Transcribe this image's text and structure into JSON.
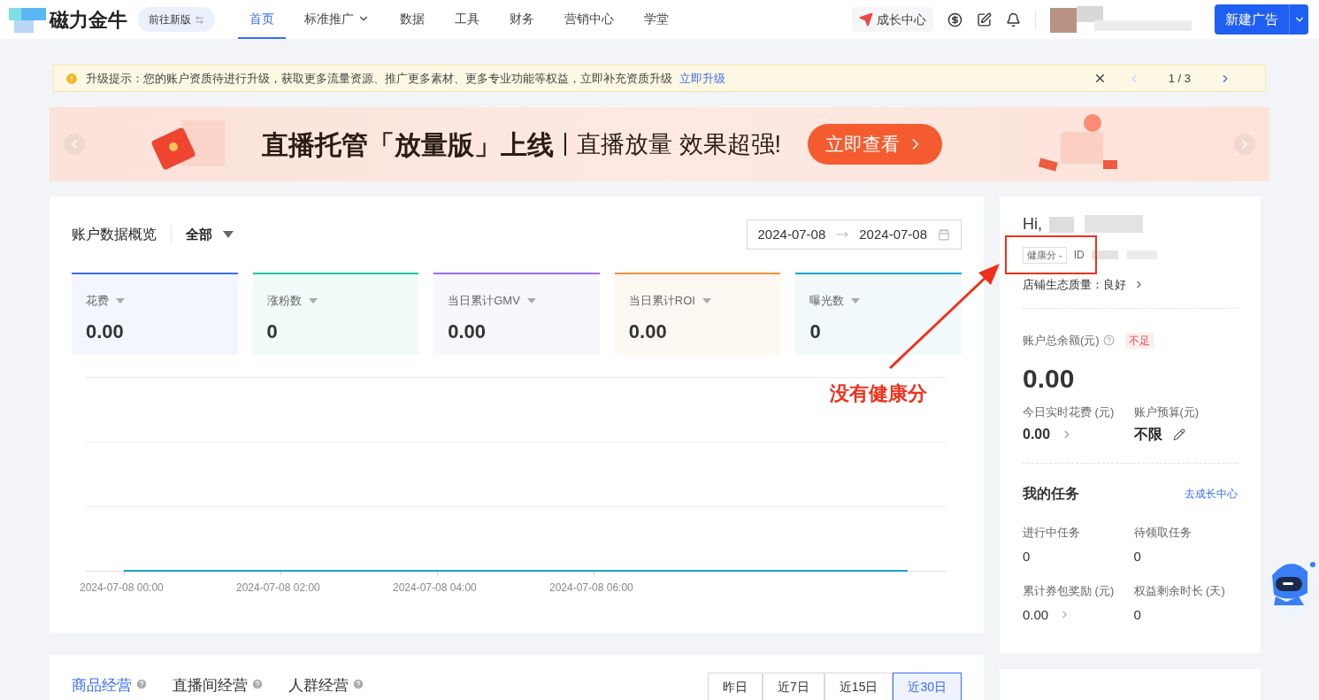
{
  "header": {
    "logo": "磁力金牛",
    "switch_version": "前往新版",
    "nav": [
      {
        "label": "首页",
        "selected": true,
        "dropdown": false
      },
      {
        "label": "标准推广",
        "selected": false,
        "dropdown": true
      },
      {
        "label": "数据",
        "selected": false,
        "dropdown": false
      },
      {
        "label": "工具",
        "selected": false,
        "dropdown": false
      },
      {
        "label": "财务",
        "selected": false,
        "dropdown": false
      },
      {
        "label": "营销中心",
        "selected": false,
        "dropdown": false
      },
      {
        "label": "学堂",
        "selected": false,
        "dropdown": false
      }
    ],
    "growth_center": "成长中心",
    "new_ad": "新建广告"
  },
  "notice": {
    "text": "升级提示：您的账户资质待进行升级，获取更多流量资源、推广更多素材、更多专业功能等权益，立即补充资质升级",
    "link": "立即升级",
    "pager": "1 / 3"
  },
  "banner": {
    "title": "直播托管「放量版」上线",
    "subtitle": "直播放量 效果超强!",
    "cta": "立即查看"
  },
  "overview": {
    "title": "账户数据概览",
    "filter": "全部",
    "date_start": "2024-07-08",
    "date_end": "2024-07-08",
    "metrics": [
      {
        "label": "花费",
        "value": "0.00",
        "color": "#3f6bf5"
      },
      {
        "label": "涨粉数",
        "value": "0",
        "color": "#23c4a0"
      },
      {
        "label": "当日累计GMV",
        "value": "0.00",
        "color": "#9a6bf5"
      },
      {
        "label": "当日累计ROI",
        "value": "0.00",
        "color": "#f5903d"
      },
      {
        "label": "曝光数",
        "value": "0",
        "color": "#1aa3c4"
      }
    ],
    "x_labels": [
      "2024-07-08 00:00",
      "2024-07-08 02:00",
      "2024-07-08 04:00",
      "2024-07-08 06:00"
    ]
  },
  "account": {
    "greeting": "Hi,",
    "health_badge": "健康分 -",
    "id_label": "ID",
    "store_quality": "店铺生态质量：良好",
    "balance_label": "账户总余额(元)",
    "balance_status": "不足",
    "balance": "0.00",
    "stats": [
      {
        "label": "今日实时花费 (元)",
        "value": "0.00",
        "kind": "link"
      },
      {
        "label": "账户预算(元)",
        "value": "不限",
        "kind": "edit"
      }
    ],
    "tasks_title": "我的任务",
    "tasks_link": "去成长中心",
    "tasks": [
      {
        "label": "进行中任务",
        "value": "0",
        "kind": "plain"
      },
      {
        "label": "待领取任务",
        "value": "0",
        "kind": "plain"
      },
      {
        "label": "累计券包奖励 (元)",
        "value": "0.00",
        "kind": "link"
      },
      {
        "label": "权益剩余时长 (天)",
        "value": "0",
        "kind": "plain"
      }
    ]
  },
  "annotation": {
    "text": "没有健康分"
  },
  "business": {
    "tabs": [
      {
        "label": "商品经营",
        "selected": true
      },
      {
        "label": "直播间经营",
        "selected": false
      },
      {
        "label": "人群经营",
        "selected": false
      }
    ],
    "ranges": [
      {
        "label": "昨日",
        "selected": false
      },
      {
        "label": "近7日",
        "selected": false
      },
      {
        "label": "近15日",
        "selected": false
      },
      {
        "label": "近30日",
        "selected": true
      }
    ]
  }
}
